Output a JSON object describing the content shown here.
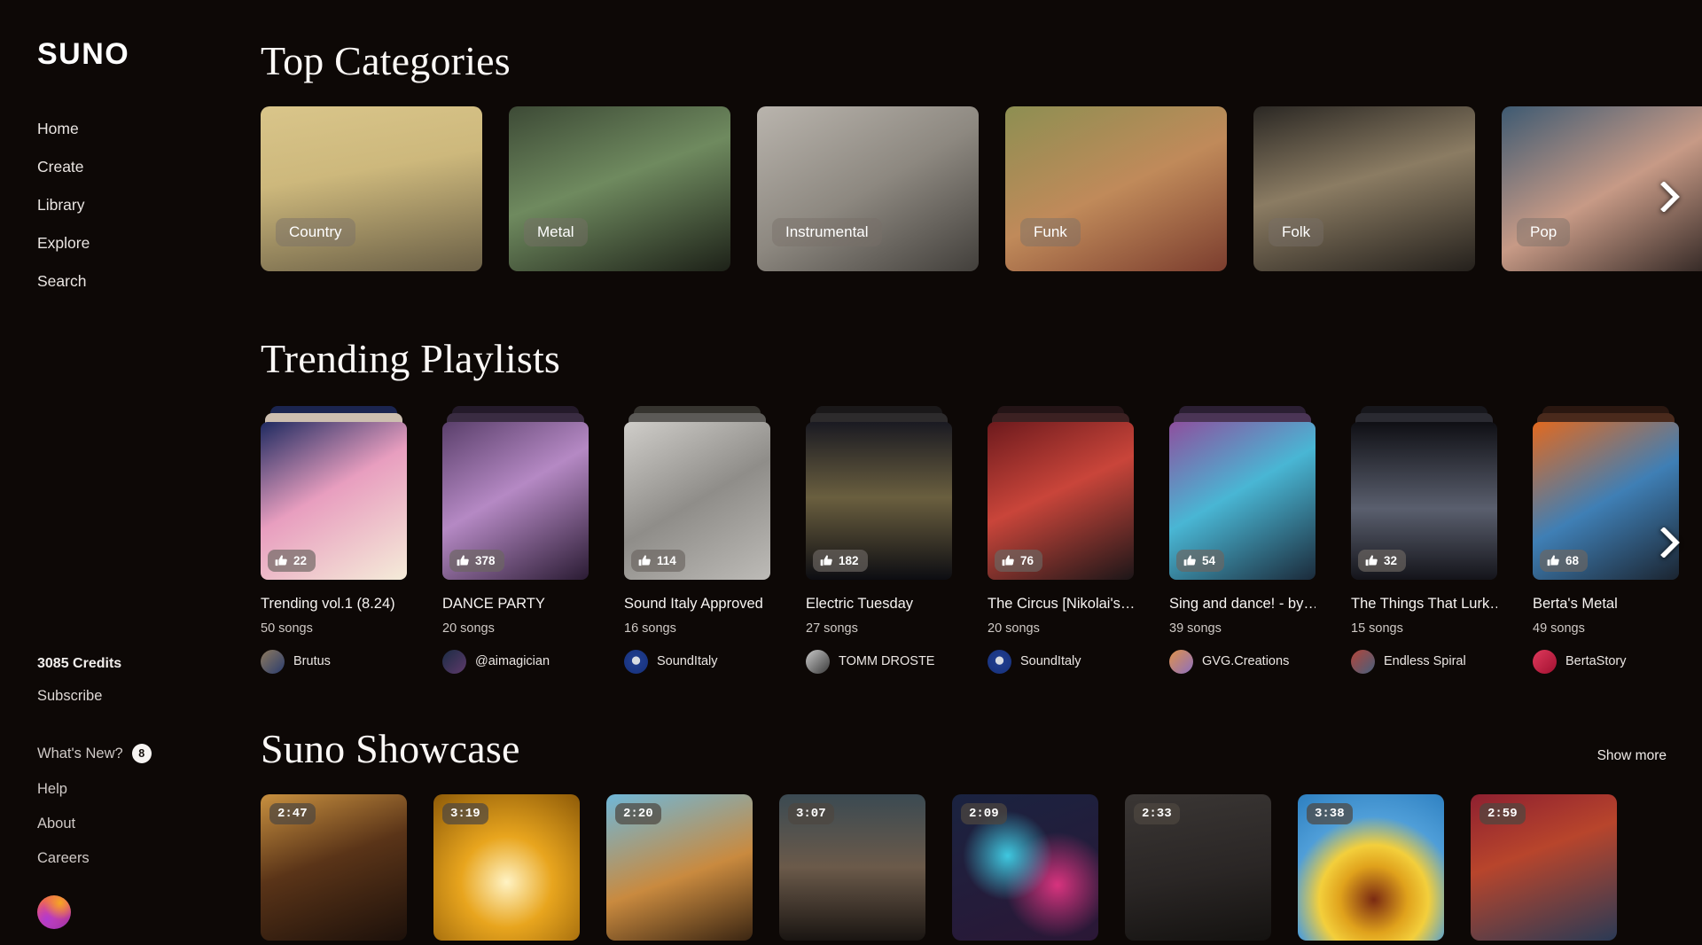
{
  "app": {
    "brand": "SUNO",
    "bg_color": "#0d0806",
    "accent_color": "#ffffff"
  },
  "sidebar": {
    "nav": [
      {
        "label": "Home",
        "active": true
      },
      {
        "label": "Create",
        "active": false
      },
      {
        "label": "Library",
        "active": false
      },
      {
        "label": "Explore",
        "active": false
      },
      {
        "label": "Search",
        "active": false
      }
    ],
    "credits": "3085 Credits",
    "subscribe": "Subscribe",
    "footer": [
      {
        "label": "What's New?",
        "badge": "8"
      },
      {
        "label": "Help",
        "badge": ""
      },
      {
        "label": "About",
        "badge": ""
      },
      {
        "label": "Careers",
        "badge": ""
      }
    ]
  },
  "categories": {
    "title": "Top Categories",
    "next_icon": "chevron-right-icon",
    "items": [
      {
        "label": "Country",
        "art": "linear-gradient(170deg,#d9c58a 0%,#cdb87c 40%,#6a5f46 100%)"
      },
      {
        "label": "Metal",
        "art": "linear-gradient(160deg,#3d4a36 0%,#6f8a5f 45%,#1d2118 100%)"
      },
      {
        "label": "Instrumental",
        "art": "linear-gradient(150deg,#b9b4ad 0%,#8d8880 50%,#423f3b 100%)"
      },
      {
        "label": "Funk",
        "art": "linear-gradient(155deg,#8d8f52 0%,#c08a5a 50%,#7b3d2e 100%)"
      },
      {
        "label": "Folk",
        "art": "linear-gradient(165deg,#2b2824 0%,#8b7c63 45%,#24201c 100%)"
      },
      {
        "label": "Pop",
        "art": "linear-gradient(150deg,#3e5a72 0%,#c79a86 50%,#2a211f 100%)"
      }
    ]
  },
  "playlists": {
    "title": "Trending Playlists",
    "next_icon": "chevron-right-icon",
    "items": [
      {
        "title": "Trending vol.1 (8.24)",
        "songs": "50 songs",
        "likes": "22",
        "author": "Brutus",
        "art": "linear-gradient(150deg,#1e2a60 0%,#e89ebf 45%,#f5ecd9 100%)",
        "avatar": "linear-gradient(135deg,#8e7a5e,#2a3c6e)",
        "tab1": "#cdbfb0",
        "tab2": "#1b2550"
      },
      {
        "title": "DANCE PARTY",
        "songs": "20 songs",
        "likes": "378",
        "author": "@aimagician",
        "art": "linear-gradient(150deg,#5a3f6b 0%,#b589c4 45%,#2a1b33 100%)",
        "avatar": "linear-gradient(135deg,#1b2c44,#5f3a6b)",
        "tab1": "#3a2c42",
        "tab2": "#241a2a"
      },
      {
        "title": "Sound Italy Approved",
        "songs": "16 songs",
        "likes": "114",
        "author": "SoundItaly",
        "art": "linear-gradient(150deg,#cfcdc9 0%,#8f8d89 50%,#bdbbb7 100%)",
        "avatar": "radial-gradient(circle at 50% 45%,#d8dce3 22%,#1f3c8c 24%,#16307a 100%)",
        "tab1": "#5c5a57",
        "tab2": "#36342f"
      },
      {
        "title": "Electric Tuesday",
        "songs": "27 songs",
        "likes": "182",
        "author": "TOMM DROSTE",
        "art": "linear-gradient(180deg,#1a1a22 0%,#6a5f3f 48%,#0d0d12 100%)",
        "avatar": "linear-gradient(135deg,#c9c9c9,#3a3a3a)",
        "tab1": "#2d2b2c",
        "tab2": "#1a1819"
      },
      {
        "title": "The Circus [Nikolai's…",
        "songs": "20 songs",
        "likes": "76",
        "author": "SoundItaly",
        "art": "linear-gradient(155deg,#6d1a1d 0%,#c9453a 45%,#1c1618 100%)",
        "avatar": "radial-gradient(circle at 50% 45%,#d8dce3 22%,#1f3c8c 24%,#16307a 100%)",
        "tab1": "#3c2122",
        "tab2": "#241416"
      },
      {
        "title": "Sing and dance! - by…",
        "songs": "39 songs",
        "likes": "54",
        "author": "GVG.Creations",
        "art": "linear-gradient(150deg,#8e4f9e 0%,#49b6d4 45%,#1b2a3a 100%)",
        "avatar": "linear-gradient(135deg,#e0924a,#8c6fc0)",
        "tab1": "#4b3556",
        "tab2": "#2b1f33"
      },
      {
        "title": "The Things That Lurk…",
        "songs": "15 songs",
        "likes": "32",
        "author": "Endless Spiral",
        "art": "linear-gradient(180deg,#0f0f14 0%,#5a5f6e 55%,#14141a 100%)",
        "avatar": "linear-gradient(135deg,#b3453a,#46607e)",
        "tab1": "#2a2a31",
        "tab2": "#17171c"
      },
      {
        "title": "Berta's Metal",
        "songs": "49 songs",
        "likes": "68",
        "author": "BertaStory",
        "art": "linear-gradient(150deg,#e2691f 0%,#3f7fb5 50%,#1b2430 100%)",
        "avatar": "linear-gradient(135deg,#e03a5c,#a01030)",
        "tab1": "#4a2a1c",
        "tab2": "#2a1710"
      }
    ]
  },
  "showcase": {
    "title": "Suno Showcase",
    "show_more": "Show more",
    "items": [
      {
        "duration": "2:47",
        "art": "linear-gradient(160deg,#c8903f 0%,#5a3418 45%,#1c100a 100%)"
      },
      {
        "duration": "3:19",
        "art": "radial-gradient(circle at 50% 60%,#fff3c4 0%,#e8a51e 40%,#8d5a08 100%)"
      },
      {
        "duration": "2:20",
        "art": "linear-gradient(160deg,#6fb7d8 0%,#c98a3f 55%,#3a2512 100%)"
      },
      {
        "duration": "3:07",
        "art": "linear-gradient(180deg,#3b4a52 0%,#6b5a4a 50%,#1a1512 100%)"
      },
      {
        "duration": "2:09",
        "art": "radial-gradient(circle at 38% 42%,#3fc8e0 0%,rgba(63,200,224,0) 36%), radial-gradient(circle at 72% 62%,#d8337e 0%,rgba(216,51,126,0) 38%), linear-gradient(160deg,#1a2340 0%,#2b1736 100%)"
      },
      {
        "duration": "2:33",
        "art": "linear-gradient(170deg,#3a3634 0%,#2a2625 55%,#141210 100%)"
      },
      {
        "duration": "3:38",
        "art": "radial-gradient(circle at 52% 72%,#7a2a12 0%,#e0a21c 26%,#f3cf3c 42%,#4f9ed8 64%,#2d7fc0 100%)"
      },
      {
        "duration": "2:59",
        "art": "linear-gradient(160deg,#8e2030 0%,#b8452c 40%,#2a3a55 100%)"
      }
    ]
  }
}
